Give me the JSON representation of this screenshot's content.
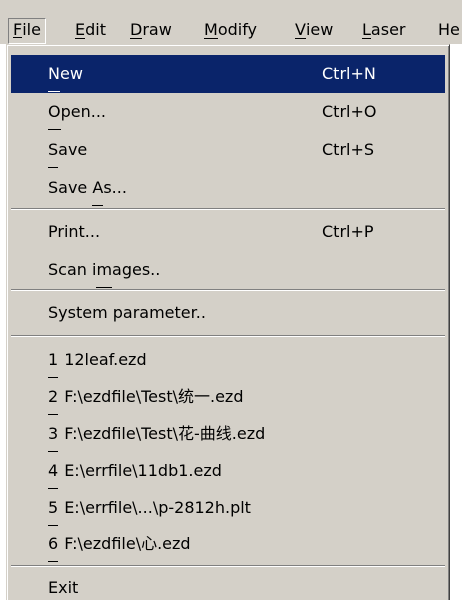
{
  "menubar": {
    "items": [
      {
        "accel": "F",
        "rest": "ile"
      },
      {
        "accel": "E",
        "rest": "dit"
      },
      {
        "accel": "D",
        "rest": "raw"
      },
      {
        "accel": "M",
        "rest": "odify"
      },
      {
        "accel": "V",
        "rest": "iew"
      },
      {
        "accel": "L",
        "rest": "aser"
      },
      {
        "accel": "",
        "rest": "He"
      }
    ],
    "active_item": "File"
  },
  "file_menu": {
    "new": {
      "pre": "",
      "accel": "N",
      "post": "ew",
      "shortcut": "Ctrl+N"
    },
    "open": {
      "pre": "",
      "accel": "O",
      "post": "pen...",
      "shortcut": "Ctrl+O"
    },
    "save": {
      "pre": "",
      "accel": "S",
      "post": "ave",
      "shortcut": "Ctrl+S"
    },
    "save_as": {
      "pre": "Save ",
      "accel": "A",
      "post": "s..."
    },
    "print": {
      "pre": "Print...",
      "shortcut": "Ctrl+P"
    },
    "scan_images": {
      "pre": "Scan i",
      "accel": "m",
      "post": "ages.."
    },
    "system_parameter": {
      "label": "System parameter.."
    },
    "recent_files": [
      {
        "num": "1",
        "path": "12leaf.ezd"
      },
      {
        "num": "2",
        "path": "F:\\ezdfile\\Test\\统一.ezd"
      },
      {
        "num": "3",
        "path": "F:\\ezdfile\\Test\\花-曲线.ezd"
      },
      {
        "num": "4",
        "path": "E:\\errfile\\11db1.ezd"
      },
      {
        "num": "5",
        "path": "E:\\errfile\\...\\p-2812h.plt"
      },
      {
        "num": "6",
        "path": "F:\\ezdfile\\心.ezd"
      }
    ],
    "exit": {
      "pre": "E",
      "accel": "x",
      "post": "it"
    }
  },
  "colors": {
    "menu_face": "#d4d0c8",
    "highlight": "#0a246a",
    "highlight_text": "#ffffff"
  }
}
